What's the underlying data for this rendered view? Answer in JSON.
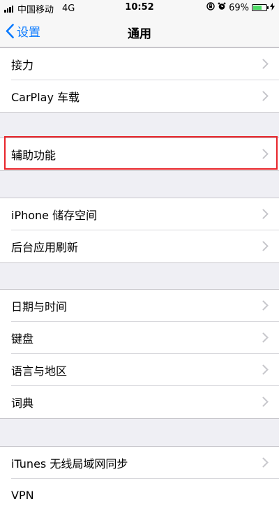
{
  "status_bar": {
    "carrier": "中国移动",
    "network": "4G",
    "time": "10:52",
    "battery_percent": "69%",
    "battery_level": 0.69,
    "battery_color": "#4cd964"
  },
  "nav": {
    "back_label": "设置",
    "title": "通用"
  },
  "groups": [
    {
      "items": [
        "接力",
        "CarPlay 车载"
      ]
    },
    {
      "items": [
        "辅助功能"
      ],
      "highlighted": true,
      "highlight_color": "#e8242a"
    },
    {
      "items": [
        "iPhone 储存空间",
        "后台应用刷新"
      ]
    },
    {
      "items": [
        "日期与时间",
        "键盘",
        "语言与地区",
        "词典"
      ]
    },
    {
      "items": [
        "iTunes 无线局域网同步",
        "VPN"
      ]
    }
  ],
  "icons": [
    "signal-bars-icon",
    "rotation-lock-icon",
    "alarm-icon",
    "battery-icon",
    "charging-icon",
    "back-chevron-icon",
    "chevron-right-icon"
  ]
}
